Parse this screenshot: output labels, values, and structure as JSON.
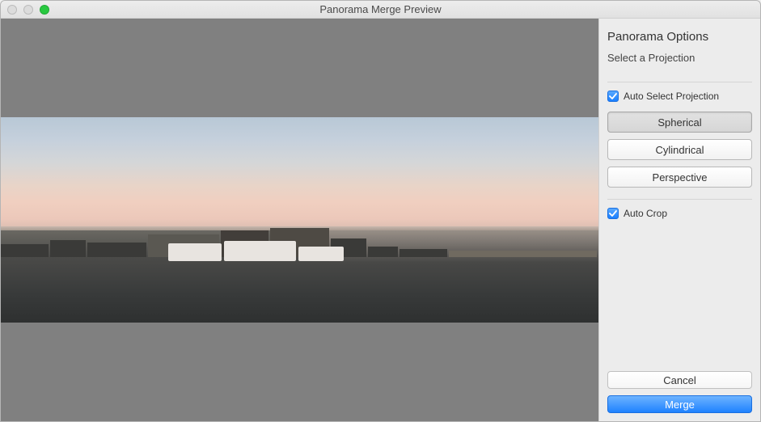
{
  "window": {
    "title": "Panorama Merge Preview"
  },
  "sidebar": {
    "title": "Panorama Options",
    "subtitle": "Select a Projection",
    "auto_select_label": "Auto Select Projection",
    "auto_select_checked": true,
    "projections": [
      {
        "label": "Spherical",
        "selected": true
      },
      {
        "label": "Cylindrical",
        "selected": false
      },
      {
        "label": "Perspective",
        "selected": false
      }
    ],
    "auto_crop_label": "Auto Crop",
    "auto_crop_checked": true
  },
  "actions": {
    "cancel": "Cancel",
    "merge": "Merge"
  }
}
